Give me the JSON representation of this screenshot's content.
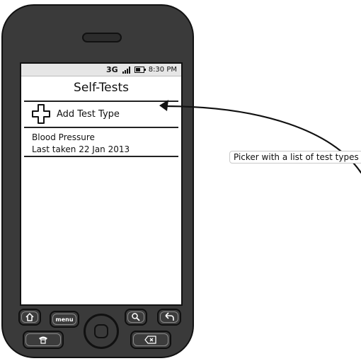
{
  "status_bar": {
    "network": "3G",
    "time": "8:30 PM"
  },
  "screen": {
    "title": "Self-Tests",
    "add_test_type_label": "Add Test Type",
    "tests": [
      {
        "name": "Blood Pressure",
        "last_taken": "Last taken 22 Jan 2013"
      }
    ]
  },
  "hardware_buttons": {
    "menu_label": "menu"
  },
  "annotation": {
    "text": "Picker with a list of test types"
  }
}
